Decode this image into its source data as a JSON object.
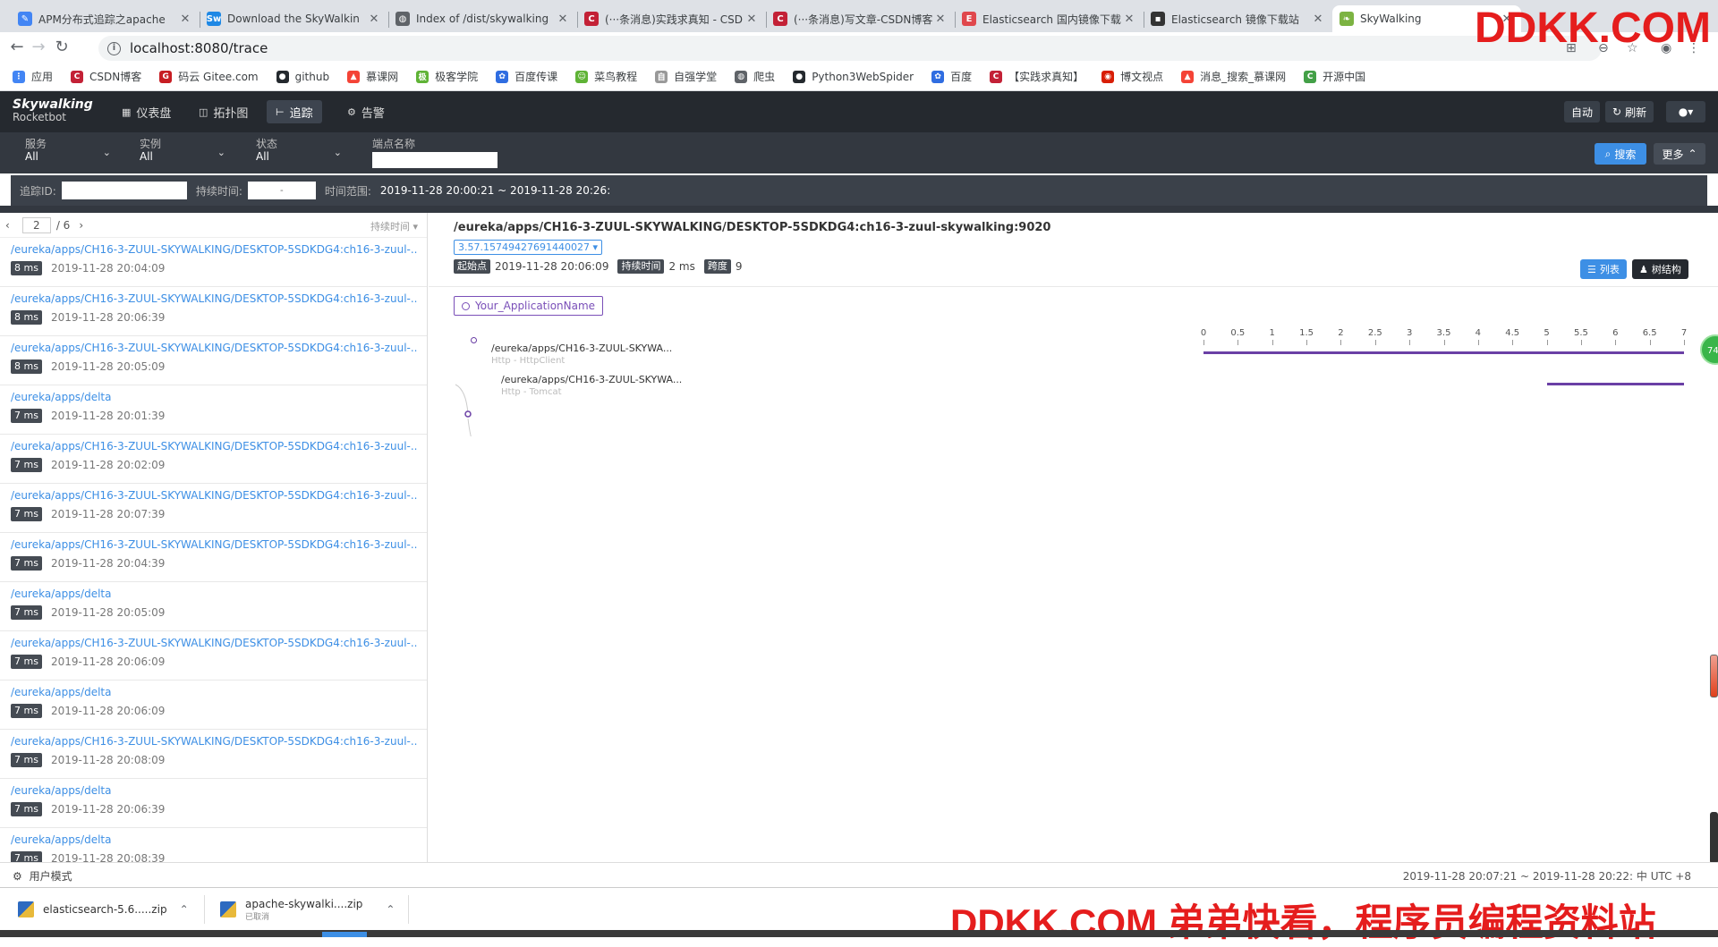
{
  "browser": {
    "tabs": [
      {
        "title": "APM分布式追踪之apache",
        "color": "#4285f4",
        "glyph": "✎"
      },
      {
        "title": "Download the SkyWalkin",
        "color": "#1e88e5",
        "glyph": "Sw"
      },
      {
        "title": "Index of /dist/skywalking",
        "color": "#5f6368",
        "glyph": "◍"
      },
      {
        "title": "(···条消息)实践求真知 - CSD",
        "color": "#c32136",
        "glyph": "C"
      },
      {
        "title": "(···条消息)写文章-CSDN博客",
        "color": "#c32136",
        "glyph": "C"
      },
      {
        "title": "Elasticsearch 国内镜像下载",
        "color": "#e0474c",
        "glyph": "E"
      },
      {
        "title": "Elasticsearch 镜像下载站",
        "color": "#333",
        "glyph": "▪"
      },
      {
        "title": "SkyWalking",
        "color": "#7cb342",
        "glyph": "❧"
      }
    ],
    "url": "localhost:8080/trace",
    "bookmarks": [
      {
        "label": "应用",
        "color": "#4285f4",
        "glyph": "⋮"
      },
      {
        "label": "CSDN博客",
        "color": "#c32136",
        "glyph": "C"
      },
      {
        "label": "码云 Gitee.com",
        "color": "#c71d23",
        "glyph": "G"
      },
      {
        "label": "github",
        "color": "#24292e",
        "glyph": "●"
      },
      {
        "label": "慕课网",
        "color": "#f44336",
        "glyph": "▲"
      },
      {
        "label": "极客学院",
        "color": "#5fb336",
        "glyph": "极"
      },
      {
        "label": "百度传课",
        "color": "#2f6de1",
        "glyph": "✿"
      },
      {
        "label": "菜鸟教程",
        "color": "#5fb336",
        "glyph": "☺"
      },
      {
        "label": "自强学堂",
        "color": "#999",
        "glyph": "自"
      },
      {
        "label": "爬虫",
        "color": "#5f6368",
        "glyph": "◍"
      },
      {
        "label": "Python3WebSpider",
        "color": "#24292e",
        "glyph": "●"
      },
      {
        "label": "百度",
        "color": "#2f6de1",
        "glyph": "✿"
      },
      {
        "label": "【实践求真知】",
        "color": "#c32136",
        "glyph": "C"
      },
      {
        "label": "博文视点",
        "color": "#d81e06",
        "glyph": "◉"
      },
      {
        "label": "消息_搜索_慕课网",
        "color": "#f44336",
        "glyph": "▲"
      },
      {
        "label": "开源中国",
        "color": "#43a047",
        "glyph": "C"
      }
    ]
  },
  "watermark": {
    "top": "DDKK.COM",
    "bottom": "DDKK.COM 弟弟快看，程序员编程资料站"
  },
  "app": {
    "logo_line1": "Skywalking",
    "logo_line2": "Rocketbot",
    "nav": [
      {
        "label": "仪表盘",
        "icon": "▦"
      },
      {
        "label": "拓扑图",
        "icon": "◫"
      },
      {
        "label": "追踪",
        "icon": "⊢"
      },
      {
        "label": "告警",
        "icon": "⚙"
      }
    ],
    "auto_label": "自动",
    "refresh_label": "刷新",
    "user_icon": "👤"
  },
  "filters": {
    "service_label": "服务",
    "service_value": "All",
    "instance_label": "实例",
    "instance_value": "All",
    "status_label": "状态",
    "status_value": "All",
    "endpoint_label": "端点名称",
    "search_label": "搜索",
    "more_label": "更多",
    "trace_id_label": "追踪ID:",
    "duration_label": "持续时间:",
    "duration_placeholder": "-",
    "time_range_label": "时间范围:",
    "time_range_value": "2019-11-28 20:00:21 ~ 2019-11-28 20:26:"
  },
  "list": {
    "current_page": "2",
    "total_pages": "/ 6",
    "sort_label": "持续时间 ▾",
    "items": [
      {
        "endpoint": "/eureka/apps/CH16-3-ZUUL-SKYWALKING/DESKTOP-5SDKDG4:ch16-3-zuul-...",
        "duration": "8 ms",
        "time": "2019-11-28 20:04:09"
      },
      {
        "endpoint": "/eureka/apps/CH16-3-ZUUL-SKYWALKING/DESKTOP-5SDKDG4:ch16-3-zuul-...",
        "duration": "8 ms",
        "time": "2019-11-28 20:06:39"
      },
      {
        "endpoint": "/eureka/apps/CH16-3-ZUUL-SKYWALKING/DESKTOP-5SDKDG4:ch16-3-zuul-...",
        "duration": "8 ms",
        "time": "2019-11-28 20:05:09"
      },
      {
        "endpoint": "/eureka/apps/delta",
        "duration": "7 ms",
        "time": "2019-11-28 20:01:39"
      },
      {
        "endpoint": "/eureka/apps/CH16-3-ZUUL-SKYWALKING/DESKTOP-5SDKDG4:ch16-3-zuul-...",
        "duration": "7 ms",
        "time": "2019-11-28 20:02:09"
      },
      {
        "endpoint": "/eureka/apps/CH16-3-ZUUL-SKYWALKING/DESKTOP-5SDKDG4:ch16-3-zuul-...",
        "duration": "7 ms",
        "time": "2019-11-28 20:07:39"
      },
      {
        "endpoint": "/eureka/apps/CH16-3-ZUUL-SKYWALKING/DESKTOP-5SDKDG4:ch16-3-zuul-...",
        "duration": "7 ms",
        "time": "2019-11-28 20:04:39"
      },
      {
        "endpoint": "/eureka/apps/delta",
        "duration": "7 ms",
        "time": "2019-11-28 20:05:09"
      },
      {
        "endpoint": "/eureka/apps/CH16-3-ZUUL-SKYWALKING/DESKTOP-5SDKDG4:ch16-3-zuul-...",
        "duration": "7 ms",
        "time": "2019-11-28 20:06:09"
      },
      {
        "endpoint": "/eureka/apps/delta",
        "duration": "7 ms",
        "time": "2019-11-28 20:06:09"
      },
      {
        "endpoint": "/eureka/apps/CH16-3-ZUUL-SKYWALKING/DESKTOP-5SDKDG4:ch16-3-zuul-...",
        "duration": "7 ms",
        "time": "2019-11-28 20:08:09"
      },
      {
        "endpoint": "/eureka/apps/delta",
        "duration": "7 ms",
        "time": "2019-11-28 20:06:39"
      },
      {
        "endpoint": "/eureka/apps/delta",
        "duration": "7 ms",
        "time": "2019-11-28 20:08:39"
      }
    ]
  },
  "detail": {
    "title": "/eureka/apps/CH16-3-ZUUL-SKYWALKING/DESKTOP-5SDKDG4:ch16-3-zuul-skywalking:9020",
    "trace_id": "3.57.15749427691440027 ▾",
    "start_label": "起始点",
    "start_value": "2019-11-28 20:06:09",
    "duration_label": "持续时间",
    "duration_value": "2 ms",
    "span_label": "跨度",
    "span_value": "9",
    "list_btn": "列表",
    "tree_btn": "树结构",
    "app_name": "Your_ApplicationName",
    "axis_ticks": [
      "0",
      "0.5",
      "1",
      "1.5",
      "2",
      "2.5",
      "3",
      "3.5",
      "4",
      "4.5",
      "5",
      "5.5",
      "6",
      "6.5",
      "7"
    ],
    "axis_max": 7,
    "spans": [
      {
        "name": "/eureka/apps/CH16-3-ZUUL-SKYWA...",
        "component": "Http - HttpClient",
        "start": 0,
        "end": 7
      },
      {
        "name": "/eureka/apps/CH16-3-ZUUL-SKYWA...",
        "component": "Http - Tomcat",
        "start": 5,
        "end": 7
      }
    ],
    "side_badge": "74"
  },
  "footer": {
    "user_mode": "用户模式",
    "range": "2019-11-28 20:07:21 ~ 2019-11-28 20:22: 中    UTC +8"
  },
  "downloads": [
    {
      "name": "elasticsearch-5.6.....zip",
      "sub": ""
    },
    {
      "name": "apache-skywalki....zip",
      "sub": "已取消"
    }
  ]
}
